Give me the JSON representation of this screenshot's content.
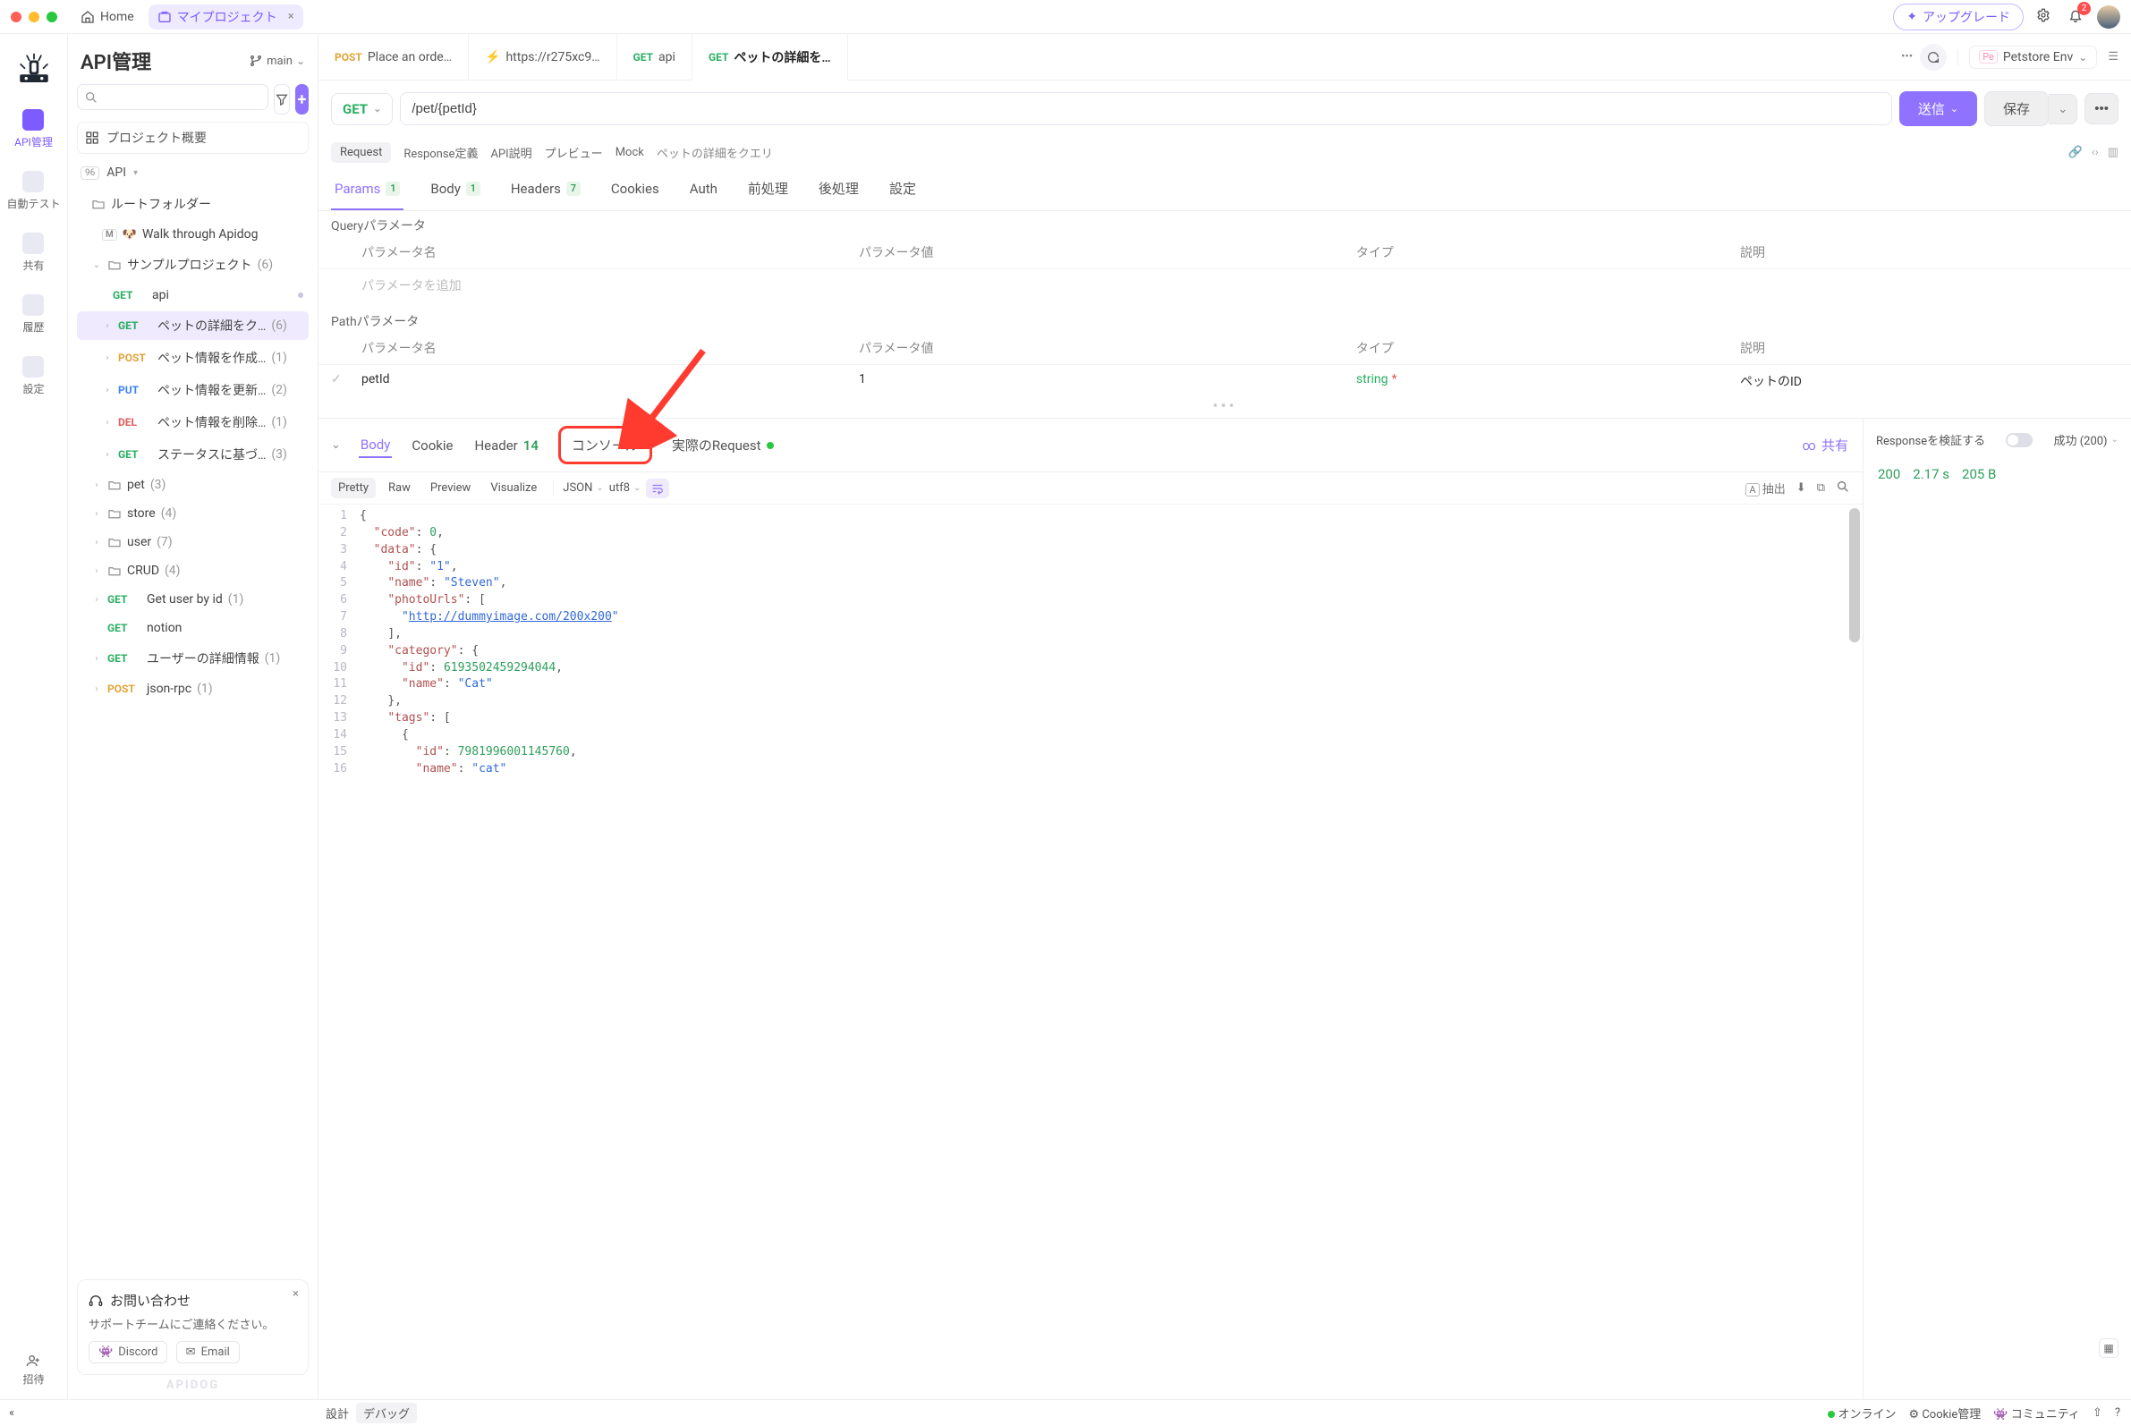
{
  "titlebar": {
    "home": "Home",
    "active_tab": "マイプロジェクト",
    "upgrade": "アップグレード",
    "notify_count": "2"
  },
  "rail": {
    "api_mgmt": "API管理",
    "autotest": "自動テスト",
    "share": "共有",
    "history": "履歴",
    "settings": "設定",
    "invite": "招待"
  },
  "sidebar": {
    "title": "API管理",
    "branch": "main",
    "project_overview": "プロジェクト概要",
    "api_label": "API",
    "tree": {
      "root_folder": "ルートフォルダー",
      "walkthrough": "Walk through Apidog",
      "sample_project": "サンプルプロジェクト",
      "sample_project_count": "(6)",
      "items": [
        {
          "method": "GET",
          "label": "api",
          "count": ""
        },
        {
          "method": "GET",
          "label": "ペットの詳細をク…",
          "count": "(6)"
        },
        {
          "method": "POST",
          "label": "ペット情報を作成…",
          "count": "(1)"
        },
        {
          "method": "PUT",
          "label": "ペット情報を更新…",
          "count": "(2)"
        },
        {
          "method": "DEL",
          "label": "ペット情報を削除…",
          "count": "(1)"
        },
        {
          "method": "GET",
          "label": "ステータスに基づ…",
          "count": "(3)"
        }
      ],
      "folders": [
        {
          "name": "pet",
          "count": "(3)"
        },
        {
          "name": "store",
          "count": "(4)"
        },
        {
          "name": "user",
          "count": "(7)"
        },
        {
          "name": "CRUD",
          "count": "(4)"
        }
      ],
      "loose": [
        {
          "method": "GET",
          "label": "Get user by id",
          "count": "(1)"
        },
        {
          "method": "GET",
          "label": "notion",
          "count": ""
        },
        {
          "method": "GET",
          "label": "ユーザーの詳細情報",
          "count": "(1)"
        },
        {
          "method": "POST",
          "label": "json-rpc",
          "count": "(1)"
        }
      ]
    },
    "contact": {
      "title": "お問い合わせ",
      "body": "サポートチームにご連絡ください。",
      "discord": "Discord",
      "email": "Email"
    },
    "watermark": "APIDOG"
  },
  "tabs": {
    "t1": {
      "method": "POST",
      "label": "Place an orde…"
    },
    "t2": {
      "label": "https://r275xc9…"
    },
    "t3": {
      "method": "GET",
      "label": "api"
    },
    "t4": {
      "method": "GET",
      "label": "ペットの詳細を…"
    }
  },
  "env": {
    "short": "Pe",
    "name": "Petstore Env"
  },
  "urlbar": {
    "method": "GET",
    "path": "/pet/{petId}",
    "send": "送信",
    "save": "保存"
  },
  "metarow": {
    "request": "Request",
    "response_def": "Response定義",
    "api_doc": "API説明",
    "preview": "プレビュー",
    "mock": "Mock",
    "title": "ペットの詳細をクエリ"
  },
  "reqtabs": {
    "params": "Params",
    "params_n": "1",
    "body": "Body",
    "body_n": "1",
    "headers": "Headers",
    "headers_n": "7",
    "cookies": "Cookies",
    "auth": "Auth",
    "pre": "前処理",
    "post": "後処理",
    "settings": "設定"
  },
  "params": {
    "query_title": "Queryパラメータ",
    "path_title": "Pathパラメータ",
    "col_name": "パラメータ名",
    "col_value": "パラメータ値",
    "col_type": "タイプ",
    "col_desc": "説明",
    "add_ph": "パラメータを追加",
    "p1_name": "petId",
    "p1_value": "1",
    "p1_type": "string",
    "p1_desc": "ペットのID"
  },
  "resp": {
    "body": "Body",
    "cookie": "Cookie",
    "header": "Header",
    "header_n": "14",
    "console": "コンソール",
    "actual": "実際のRequest",
    "share": "共有",
    "fmt_pretty": "Pretty",
    "fmt_raw": "Raw",
    "fmt_preview": "Preview",
    "fmt_visual": "Visualize",
    "lang": "JSON",
    "enc": "utf8",
    "extract": "抽出",
    "validate_label": "Responseを検証する",
    "status_label": "成功 (200)",
    "stat_code": "200",
    "stat_time": "2.17 s",
    "stat_size": "205 B"
  },
  "code": [
    "{",
    "  \"code\": 0,",
    "  \"data\": {",
    "    \"id\": \"1\",",
    "    \"name\": \"Steven\",",
    "    \"photoUrls\": [",
    "      \"http://dummyimage.com/200x200\"",
    "    ],",
    "    \"category\": {",
    "      \"id\": 6193502459294044,",
    "      \"name\": \"Cat\"",
    "    },",
    "    \"tags\": [",
    "      {",
    "        \"id\": 7981996001145760,",
    "        \"name\": \"cat\""
  ],
  "footer": {
    "design": "設計",
    "debug": "デバッグ",
    "online": "オンライン",
    "cookie": "Cookie管理",
    "community": "コミュニティ"
  }
}
